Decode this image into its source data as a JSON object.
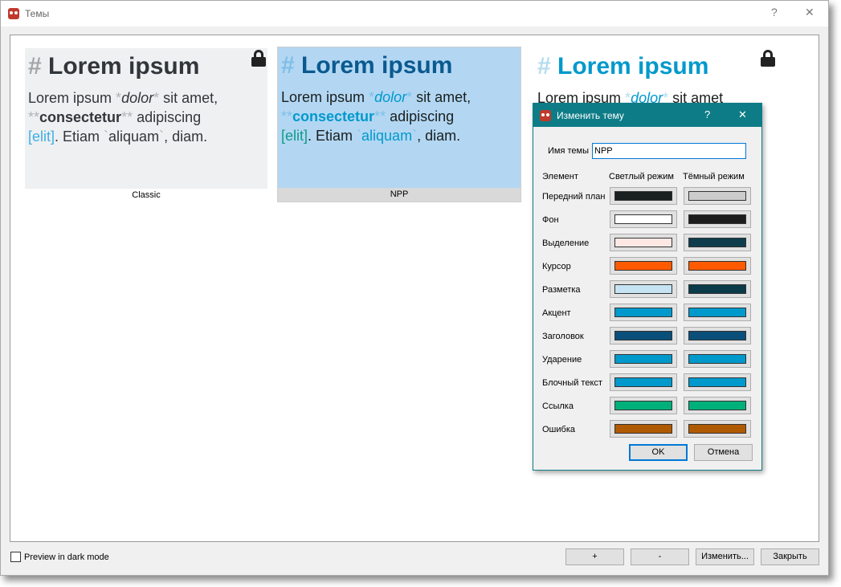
{
  "window": {
    "title": "Темы",
    "help": "?",
    "close": "✕"
  },
  "themes": [
    {
      "name": "Classic",
      "locked": true,
      "heading_hash": "#",
      "heading": "Lorem ipsum",
      "body": {
        "t1": "Lorem ipsum ",
        "em_mark": "*",
        "em": "dolor",
        "t2": " sit amet,",
        "strong_mark": "**",
        "strong": "consectetur",
        "t3": " adipiscing",
        "link": "[elit]",
        "t4": ". Etiam ",
        "code_mark": "`",
        "code": "aliquam",
        "t5": ", diam."
      },
      "colors": {
        "bg": "#eff0f1",
        "fg": "#31363b",
        "heading": "#31363b",
        "hash": "#a3a6a9",
        "mark": "#b0b4b8",
        "link": "#3daee9",
        "code": "#31363b",
        "strong": "#31363b",
        "em": "#31363b"
      }
    },
    {
      "name": "NPP",
      "locked": false,
      "selected": true,
      "heading_hash": "#",
      "heading": "Lorem ipsum",
      "body": {
        "t1": "Lorem ipsum ",
        "em_mark": "*",
        "em": "dolor",
        "t2": " sit amet,",
        "strong_mark": "**",
        "strong": "consectetur",
        "t3": " adipiscing",
        "link": "[elit]",
        "t4": ". Etiam ",
        "code_mark": "`",
        "code": "aliquam",
        "t5": ", diam."
      },
      "colors": {
        "bg": "#b3d7f3",
        "fg": "#1a1f1f",
        "heading": "#0a5a8f",
        "hash": "#7fbfe6",
        "mark": "#7fbfe6",
        "link": "#0f9a8a",
        "code": "#0099cc",
        "strong": "#0099cc",
        "em": "#0099cc"
      }
    },
    {
      "name": "",
      "locked": true,
      "heading_hash": "#",
      "heading": "Lorem ipsum",
      "body": {
        "t1": "Lorem ipsum ",
        "em_mark": "*",
        "em": "dolor",
        "t2": " sit amet"
      },
      "colors": {
        "bg": "#ffffff",
        "fg": "#1a1f1f",
        "heading": "#0099cc",
        "hash": "#b3dcee",
        "mark": "#b3dcee",
        "em": "#0099cc"
      }
    }
  ],
  "dialog": {
    "title": "Изменить тему",
    "help": "?",
    "close": "✕",
    "name_label": "Имя темы",
    "name_value": "NPP",
    "col_element": "Элемент",
    "col_light": "Светлый режим",
    "col_dark": "Тёмный режим",
    "rows": [
      {
        "label": "Передний план",
        "light": "#1a1f1f",
        "dark": "#cccccc"
      },
      {
        "label": "Фон",
        "light": "#ffffff",
        "dark": "#1c1c1c"
      },
      {
        "label": "Выделение",
        "light": "#fde8e4",
        "dark": "#0d3d4d"
      },
      {
        "label": "Курсор",
        "light": "#ff5a00",
        "dark": "#ff5a00"
      },
      {
        "label": "Разметка",
        "light": "#c5e3f2",
        "dark": "#0a3b48"
      },
      {
        "label": "Акцент",
        "light": "#0099cc",
        "dark": "#0099cc"
      },
      {
        "label": "Заголовок",
        "light": "#0a4f7a",
        "dark": "#0a4f7a"
      },
      {
        "label": "Ударение",
        "light": "#0099cc",
        "dark": "#0099cc"
      },
      {
        "label": "Блочный текст",
        "light": "#0099cc",
        "dark": "#0099cc"
      },
      {
        "label": "Ссылка",
        "light": "#00b07a",
        "dark": "#00b07a"
      },
      {
        "label": "Ошибка",
        "light": "#b05a00",
        "dark": "#b05a00"
      }
    ],
    "ok": "OK",
    "cancel": "Отмена"
  },
  "footer": {
    "dark_preview_label": "Preview in dark mode",
    "dark_preview_checked": false,
    "add": "+",
    "remove": "-",
    "edit": "Изменить...",
    "close": "Закрыть"
  },
  "accent": "#0e7c86"
}
